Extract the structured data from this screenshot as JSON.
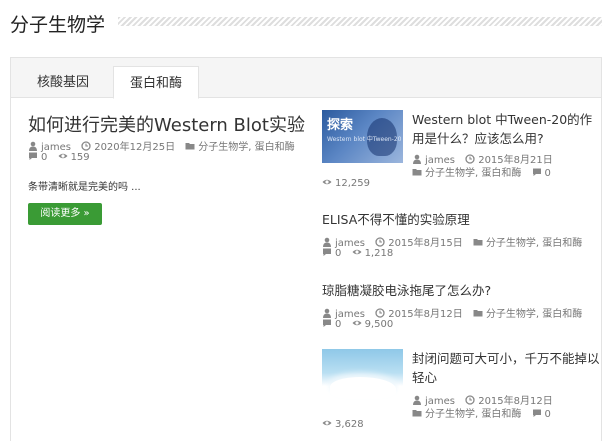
{
  "section": {
    "title": "分子生物学"
  },
  "tabs": [
    {
      "label": "核酸基因",
      "active": false
    },
    {
      "label": "蛋白和酶",
      "active": true
    }
  ],
  "main_post": {
    "title": "如何进行完美的Western Blot实验",
    "author": "james",
    "date": "2020年12月25日",
    "categories": "分子生物学, 蛋白和酶",
    "comments": "0",
    "views": "159",
    "excerpt": "条带清晰就是完美的吗 ...",
    "read_more": "阅读更多 »"
  },
  "side_posts": [
    {
      "title": "Western blot 中Tween-20的作用是什么？应该怎么用?",
      "author": "james",
      "date": "2015年8月21日",
      "categories": "分子生物学, 蛋白和酶",
      "comments": "0",
      "views": "12,259",
      "thumb_text": "探索",
      "thumb_subtext": "Western blot 中Tween-20"
    },
    {
      "title": "ELISA不得不懂的实验原理",
      "author": "james",
      "date": "2015年8月15日",
      "categories": "分子生物学, 蛋白和酶",
      "comments": "0",
      "views": "1,218"
    },
    {
      "title": "琼脂糖凝胶电泳拖尾了怎么办?",
      "author": "james",
      "date": "2015年8月12日",
      "categories": "分子生物学, 蛋白和酶",
      "comments": "0",
      "views": "9,500"
    },
    {
      "title": "封闭问题可大可小，千万不能掉以轻心",
      "author": "james",
      "date": "2015年8月12日",
      "categories": "分子生物学, 蛋白和酶",
      "comments": "0",
      "views": "3,628"
    }
  ],
  "colors": {
    "accent_button": "#3a9b35",
    "meta_text": "#777777"
  },
  "icons": [
    "user-icon",
    "clock-icon",
    "folder-icon",
    "comment-icon",
    "eye-icon"
  ]
}
